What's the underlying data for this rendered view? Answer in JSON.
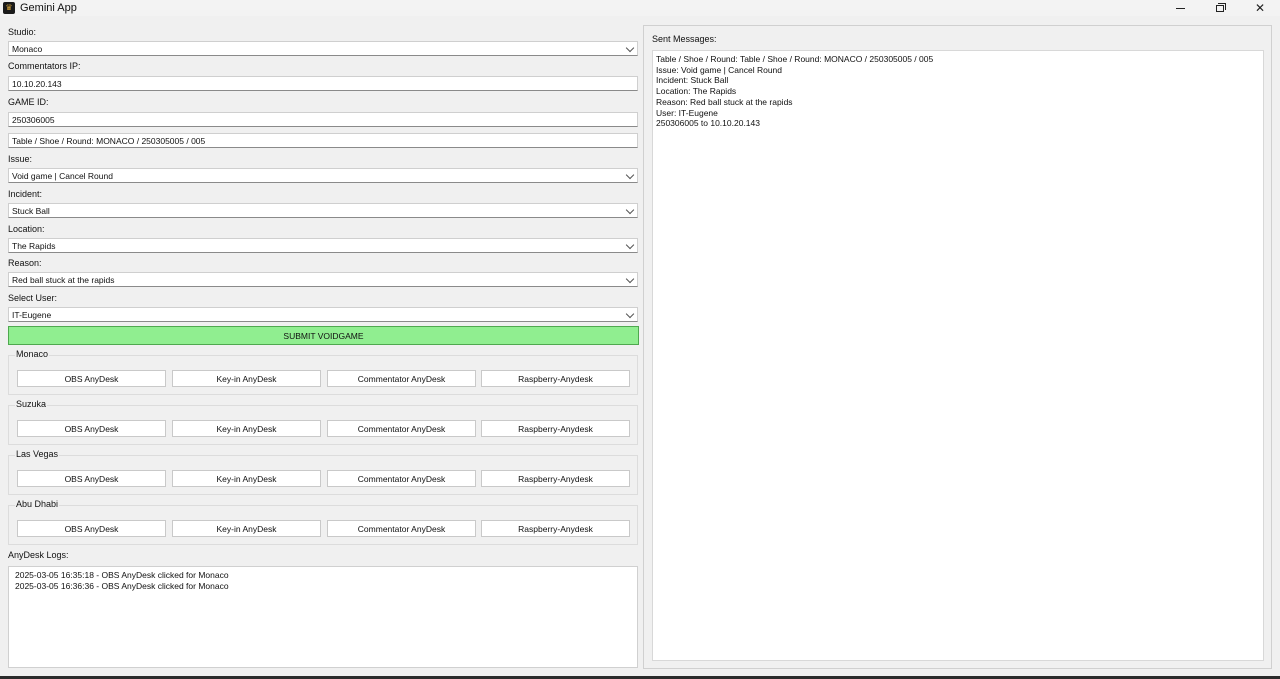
{
  "window": {
    "title": "Gemini App"
  },
  "form": {
    "studio_label": "Studio:",
    "studio_value": "Monaco",
    "ip_label": "Commentators IP:",
    "ip_value": "10.10.20.143",
    "gameid_label": "GAME ID:",
    "gameid_value": "250306005",
    "table_value": "Table / Shoe / Round: MONACO / 250305005 / 005",
    "issue_label": "Issue:",
    "issue_value": "Void game | Cancel Round",
    "incident_label": "Incident:",
    "incident_value": "Stuck Ball",
    "location_label": "Location:",
    "location_value": "The Rapids",
    "reason_label": "Reason:",
    "reason_value": "Red ball stuck at the rapids",
    "user_label": "Select User:",
    "user_value": "IT-Eugene",
    "submit_label": "SUBMIT VOIDGAME"
  },
  "groups": [
    {
      "title": "Monaco",
      "buttons": [
        "OBS AnyDesk",
        "Key-in AnyDesk",
        "Commentator AnyDesk",
        "Raspberry-Anydesk"
      ]
    },
    {
      "title": "Suzuka",
      "buttons": [
        "OBS AnyDesk",
        "Key-in AnyDesk",
        "Commentator AnyDesk",
        "Raspberry-Anydesk"
      ]
    },
    {
      "title": "Las Vegas",
      "buttons": [
        "OBS AnyDesk",
        "Key-in AnyDesk",
        "Commentator AnyDesk",
        "Raspberry-Anydesk"
      ]
    },
    {
      "title": "Abu Dhabi",
      "buttons": [
        "OBS AnyDesk",
        "Key-in AnyDesk",
        "Commentator AnyDesk",
        "Raspberry-Anydesk"
      ]
    }
  ],
  "logs": {
    "label": "AnyDesk Logs:",
    "lines": [
      "2025-03-05 16:35:18 - OBS AnyDesk clicked for Monaco",
      "2025-03-05 16:36:36 - OBS AnyDesk clicked for Monaco"
    ]
  },
  "sent": {
    "label": "Sent Messages:",
    "lines": [
      "Table / Shoe / Round: Table / Shoe / Round: MONACO / 250305005 / 005",
      "Issue: Void game | Cancel Round",
      "Incident: Stuck Ball",
      "Location: The Rapids",
      "Reason: Red ball stuck at the rapids",
      "User: IT-Eugene",
      "250306005 to 10.10.20.143"
    ]
  },
  "colors": {
    "submit_bg": "#90ee90",
    "background": "#f0f0f0"
  },
  "icons": {
    "app": "gemini-logo-icon",
    "minimize": "minimize-icon",
    "restore": "restore-icon",
    "close": "close-icon"
  }
}
